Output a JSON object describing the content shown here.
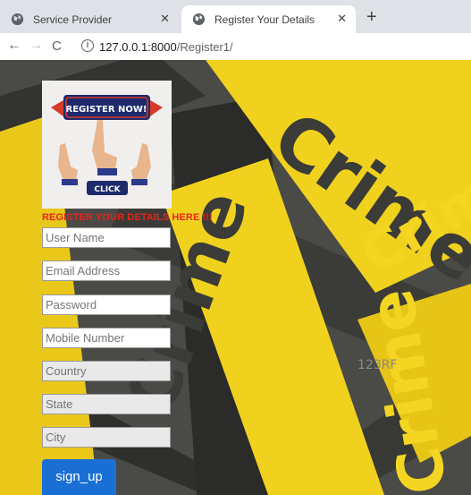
{
  "tabs": [
    {
      "title": "Service Provider",
      "active": false
    },
    {
      "title": "Register Your Details",
      "active": true
    }
  ],
  "address_bar": {
    "host": "127.0.0.1:8000",
    "path": "/Register1/"
  },
  "background": {
    "subject": "stock photo of crossed yellow crime scene tapes",
    "tape_words": [
      "Crime",
      "Crime",
      "Crime",
      "Crime"
    ],
    "watermark": "123RF",
    "colors": {
      "tape_yellow": "#f0d21e",
      "tape_dark": "#3b3b38",
      "tape_letter": "#f4d622"
    }
  },
  "register_image": {
    "banner_text": "REGISTER NOW!",
    "button_text": "CLICK"
  },
  "form": {
    "heading": "REGISTER YOUR DETAILS HERE !!!",
    "fields": [
      {
        "name": "username",
        "placeholder": "User Name"
      },
      {
        "name": "email",
        "placeholder": "Email Address"
      },
      {
        "name": "password",
        "placeholder": "Password"
      },
      {
        "name": "mobile",
        "placeholder": "Mobile Number"
      },
      {
        "name": "country",
        "placeholder": "Country"
      },
      {
        "name": "state",
        "placeholder": "State"
      },
      {
        "name": "city",
        "placeholder": "City"
      }
    ],
    "submit_label": "sign_up"
  },
  "colors": {
    "heading_red": "#e8241a",
    "button_blue": "#1a6fd4"
  }
}
